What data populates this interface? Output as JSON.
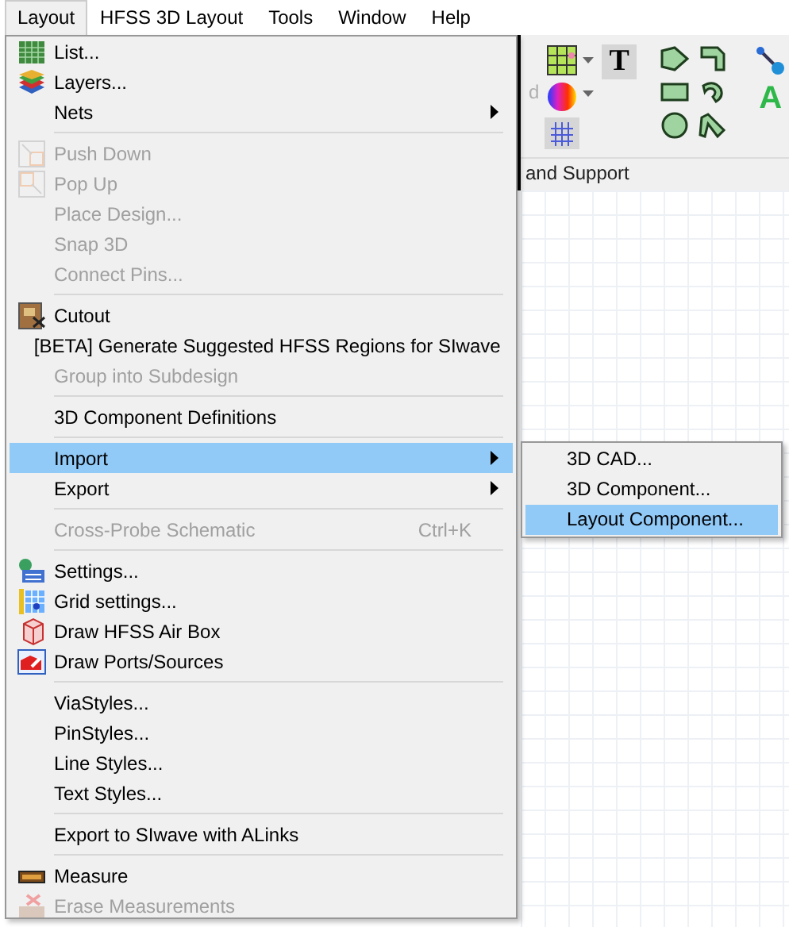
{
  "menubar": [
    {
      "label": "Layout",
      "selected": true
    },
    {
      "label": "HFSS 3D Layout",
      "selected": false
    },
    {
      "label": "Tools",
      "selected": false
    },
    {
      "label": "Window",
      "selected": false
    },
    {
      "label": "Help",
      "selected": false
    }
  ],
  "toolbar": {
    "hidden_label": "d",
    "text_tool": "T",
    "label_tool": "A",
    "group_label": "and Support"
  },
  "menu": {
    "items": [
      {
        "kind": "item",
        "label": "List...",
        "disabled": false,
        "selected": false,
        "submenu": false
      },
      {
        "kind": "item",
        "label": "Layers...",
        "disabled": false,
        "selected": false,
        "submenu": false
      },
      {
        "kind": "item",
        "label": "Nets",
        "disabled": false,
        "selected": false,
        "submenu": true
      },
      {
        "kind": "separator"
      },
      {
        "kind": "item",
        "label": "Push Down",
        "disabled": true,
        "selected": false,
        "submenu": false
      },
      {
        "kind": "item",
        "label": "Pop Up",
        "disabled": true,
        "selected": false,
        "submenu": false
      },
      {
        "kind": "item",
        "label": "Place Design...",
        "disabled": true,
        "selected": false,
        "submenu": false
      },
      {
        "kind": "item",
        "label": "Snap 3D",
        "disabled": true,
        "selected": false,
        "submenu": false
      },
      {
        "kind": "item",
        "label": "Connect Pins...",
        "disabled": true,
        "selected": false,
        "submenu": false
      },
      {
        "kind": "separator"
      },
      {
        "kind": "item",
        "label": "Cutout",
        "disabled": false,
        "selected": false,
        "submenu": false
      },
      {
        "kind": "item",
        "label": "[BETA] Generate Suggested HFSS Regions for SIwave",
        "disabled": false,
        "selected": false,
        "submenu": false
      },
      {
        "kind": "item",
        "label": "Group into Subdesign",
        "disabled": true,
        "selected": false,
        "submenu": false
      },
      {
        "kind": "separator"
      },
      {
        "kind": "item",
        "label": "3D Component Definitions",
        "disabled": false,
        "selected": false,
        "submenu": false
      },
      {
        "kind": "separator"
      },
      {
        "kind": "item",
        "label": "Import",
        "disabled": false,
        "selected": true,
        "submenu": true
      },
      {
        "kind": "item",
        "label": "Export",
        "disabled": false,
        "selected": false,
        "submenu": true
      },
      {
        "kind": "separator"
      },
      {
        "kind": "item",
        "label": "Cross-Probe Schematic",
        "shortcut": "Ctrl+K",
        "disabled": true,
        "selected": false,
        "submenu": false
      },
      {
        "kind": "separator"
      },
      {
        "kind": "item",
        "label": "Settings...",
        "disabled": false,
        "selected": false,
        "submenu": false
      },
      {
        "kind": "item",
        "label": "Grid settings...",
        "disabled": false,
        "selected": false,
        "submenu": false
      },
      {
        "kind": "item",
        "label": "Draw HFSS Air Box",
        "disabled": false,
        "selected": false,
        "submenu": false
      },
      {
        "kind": "item",
        "label": "Draw Ports/Sources",
        "disabled": false,
        "selected": false,
        "submenu": false
      },
      {
        "kind": "separator"
      },
      {
        "kind": "item",
        "label": "ViaStyles...",
        "disabled": false,
        "selected": false,
        "submenu": false
      },
      {
        "kind": "item",
        "label": "PinStyles...",
        "disabled": false,
        "selected": false,
        "submenu": false
      },
      {
        "kind": "item",
        "label": "Line Styles...",
        "disabled": false,
        "selected": false,
        "submenu": false
      },
      {
        "kind": "item",
        "label": "Text Styles...",
        "disabled": false,
        "selected": false,
        "submenu": false
      },
      {
        "kind": "separator"
      },
      {
        "kind": "item",
        "label": "Export to SIwave with ALinks",
        "disabled": false,
        "selected": false,
        "submenu": false
      },
      {
        "kind": "separator"
      },
      {
        "kind": "item",
        "label": "Measure",
        "disabled": false,
        "selected": false,
        "submenu": false
      },
      {
        "kind": "item",
        "label": "Erase Measurements",
        "disabled": true,
        "selected": false,
        "submenu": false
      }
    ]
  },
  "submenu": {
    "items": [
      {
        "label": "3D CAD...",
        "selected": false
      },
      {
        "label": "3D Component...",
        "selected": false
      },
      {
        "label": "Layout Component...",
        "selected": true
      }
    ]
  }
}
